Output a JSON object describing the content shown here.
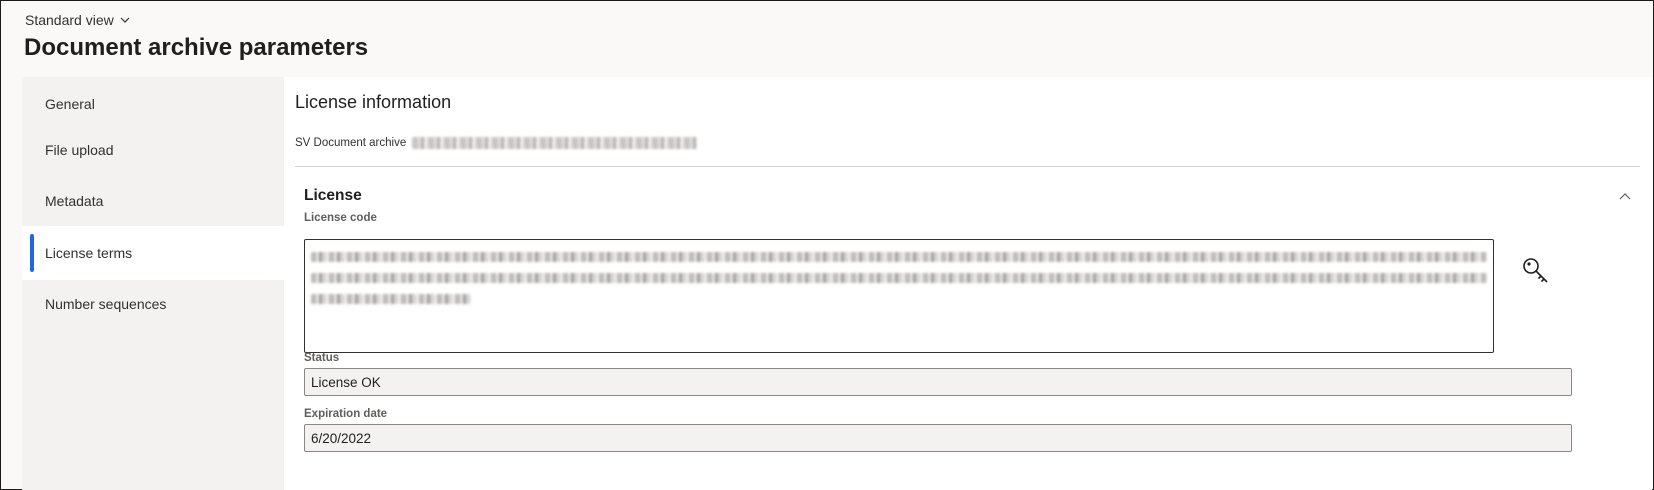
{
  "header": {
    "view_selector": "Standard view",
    "title": "Document archive parameters"
  },
  "sidebar": {
    "items": [
      {
        "label": "General"
      },
      {
        "label": "File upload"
      },
      {
        "label": "Metadata"
      },
      {
        "label": "License terms",
        "active": true
      },
      {
        "label": "Number sequences"
      }
    ]
  },
  "main": {
    "section_title": "License information",
    "product_label": "SV Document archive",
    "fasttab": {
      "title": "License",
      "license_code_label": "License code",
      "status_label": "Status",
      "status_value": "License OK",
      "expiration_label": "Expiration date",
      "expiration_value": "6/20/2022"
    }
  },
  "colors": {
    "accent": "#2266e3",
    "sidebar_bg": "#f3f2f1",
    "page_bg": "#faf9f8"
  },
  "icons": {
    "view_selector": "chevron-down-icon",
    "fasttab_toggle": "chevron-up-icon",
    "validate_license": "key-icon"
  }
}
